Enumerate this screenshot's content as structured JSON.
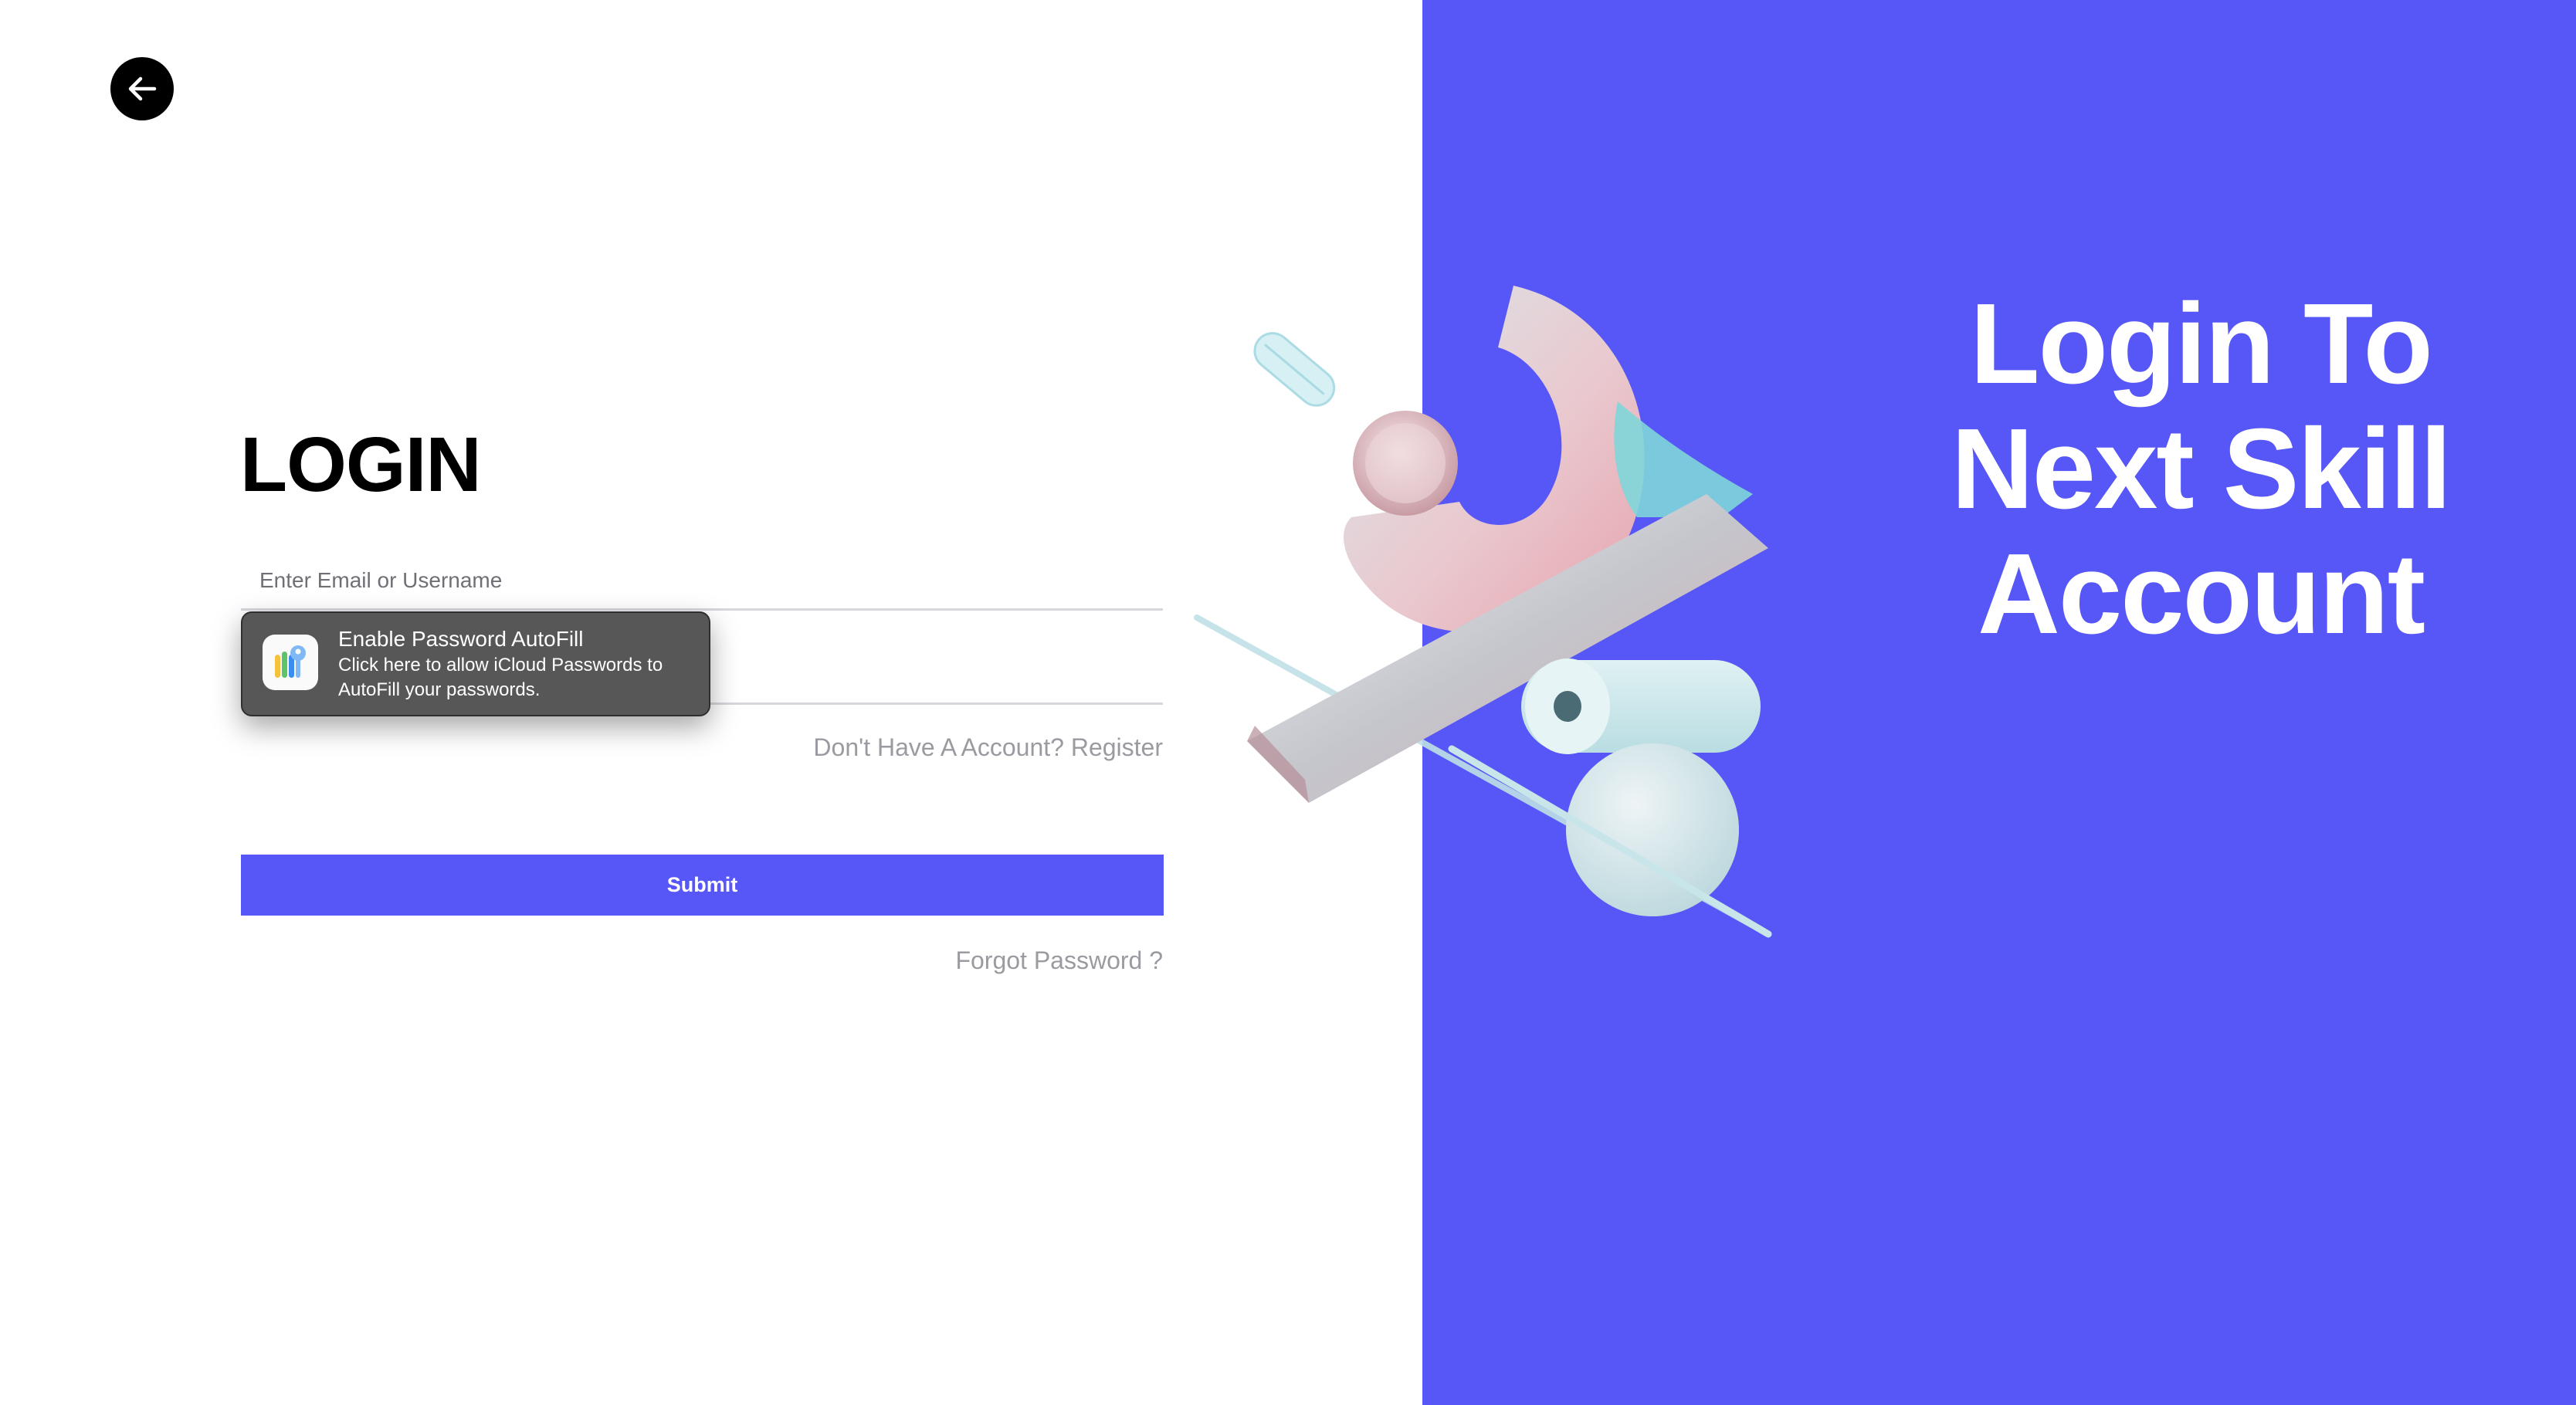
{
  "login": {
    "title": "LOGIN",
    "email_placeholder": "Enter Email or Username",
    "password_placeholder": "",
    "register_link": "Don't Have A Account? Register",
    "submit_label": "Submit",
    "forgot_link": "Forgot Password ?"
  },
  "autofill": {
    "title": "Enable Password AutoFill",
    "description": "Click here to allow iCloud Passwords to AutoFill your passwords.",
    "icon": "passwords-app-icon"
  },
  "hero": {
    "title": "Login To Next Skill Account"
  },
  "colors": {
    "accent": "#5756f6",
    "popup_bg": "#575757",
    "link_gray": "#9a9aa1"
  },
  "icons": {
    "back": "arrow-left-icon"
  }
}
